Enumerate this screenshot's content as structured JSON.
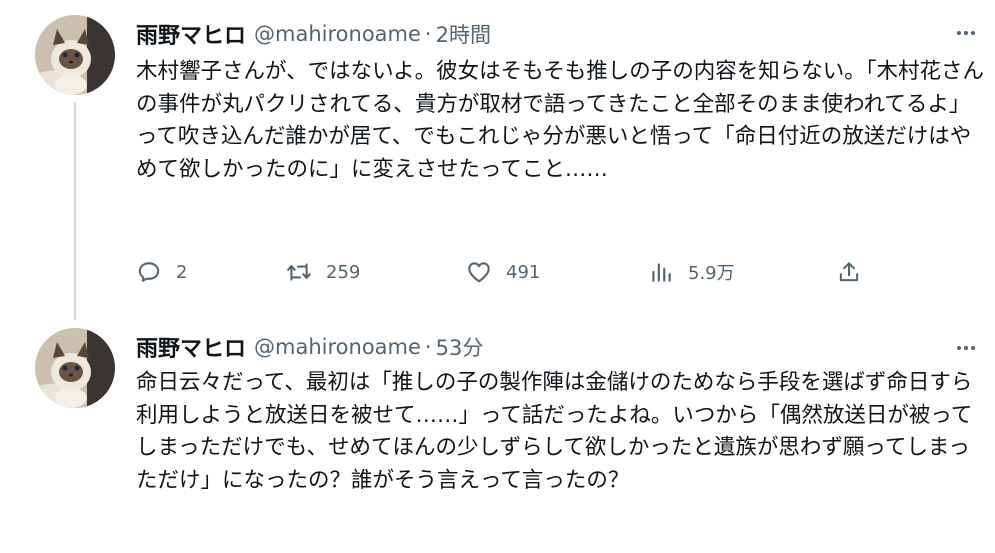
{
  "tweets": [
    {
      "author": {
        "name": "雨野マヒロ",
        "handle": "@mahironoame"
      },
      "separator": "·",
      "time": "2時間",
      "text": "木村響子さんが、ではないよ。彼女はそもそも推しの子の内容を知らない。「木村花さんの事件が丸パクリされてる、貴方が取材で語ってきたこと全部そのまま使われてるよ」って吹き込んだ誰かが居て、でもこれじゃ分が悪いと悟って「命日付近の放送だけはやめて欲しかったのに」に変えさせたってこと……",
      "stats": {
        "replies": "2",
        "retweets": "259",
        "likes": "491",
        "views": "5.9万"
      }
    },
    {
      "author": {
        "name": "雨野マヒロ",
        "handle": "@mahironoame"
      },
      "separator": "·",
      "time": "53分",
      "text": "命日云々だって、最初は「推しの子の製作陣は金儲けのためなら手段を選ばず命日すら利用しようと放送日を被せて……」って話だったよね。いつから「偶然放送日が被ってしまっただけでも、せめてほんの少しずらして欲しかったと遺族が思わず願ってしまっただけ」になったの？誰がそう言えって言ったの？"
    }
  ],
  "icons": {
    "more": "more-dots-icon",
    "reply": "reply-icon",
    "retweet": "retweet-icon",
    "like": "like-icon",
    "views": "views-icon",
    "share": "share-icon"
  },
  "colors": {
    "text": "#0f1419",
    "secondary": "#536471",
    "thread": "#cfd9de"
  }
}
